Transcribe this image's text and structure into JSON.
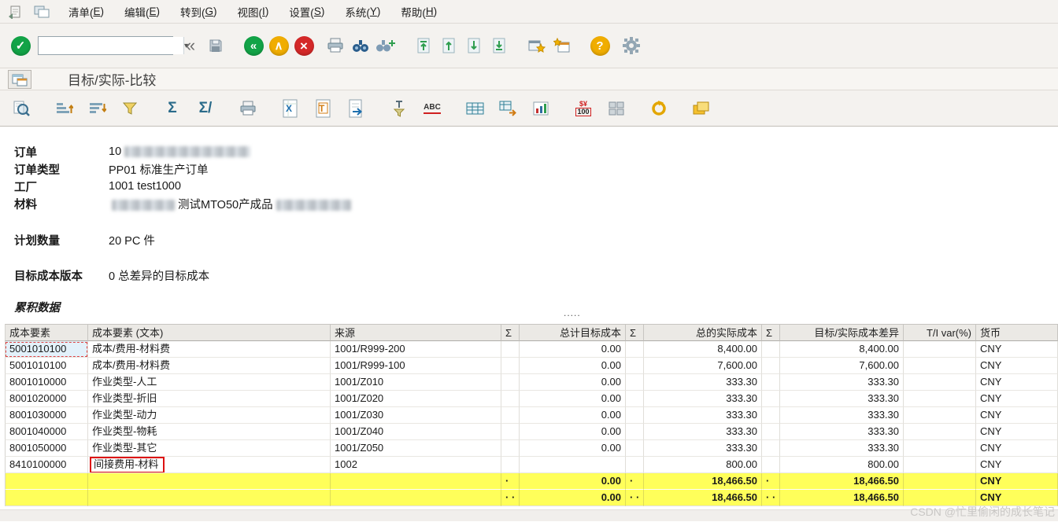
{
  "accent_colors": {
    "enter_green": "#12a347",
    "exit_amber": "#f0ad00",
    "cancel_red": "#d42828",
    "row_highlight_yellow": "#ffff5a",
    "annotation_red": "#dd1111",
    "selection_blue": "#e3f1fa"
  },
  "menubar": {
    "items": [
      {
        "pre": "清单(",
        "key": "E",
        "post": ")"
      },
      {
        "pre": "编辑(",
        "key": "E",
        "post": ")"
      },
      {
        "pre": "转到(",
        "key": "G",
        "post": ")"
      },
      {
        "pre": "视图(",
        "key": "I",
        "post": ")"
      },
      {
        "pre": "设置(",
        "key": "S",
        "post": ")"
      },
      {
        "pre": "系统(",
        "key": "Y",
        "post": ")"
      },
      {
        "pre": "帮助(",
        "key": "H",
        "post": ")"
      }
    ]
  },
  "toolbar": {
    "command_field_value": "",
    "glyphs": {
      "enter": "✓",
      "dropdown": "▾",
      "collapse": "«",
      "back": "«",
      "exit": "∧",
      "cancel": "×",
      "help": "?"
    }
  },
  "titlebar": {
    "title": "目标/实际-比较"
  },
  "app_toolbar": {
    "glyphs": {
      "sum": "Σ",
      "subtotal": "Σ/",
      "spreadsheet": "X",
      "word": "T",
      "abc": "ABC",
      "currency_top": "$¥",
      "currency_bottom": "100"
    }
  },
  "header_info": {
    "order_label": "订单",
    "order_value_visible": "10",
    "order_type_label": "订单类型",
    "order_type_value": "PP01 标准生产订单",
    "plant_label": "工厂",
    "plant_value": "1001 test1000",
    "material_label": "材料",
    "material_value_visible": "测试MTO50产成品",
    "qty_label": "计划数量",
    "qty_value": "20 PC 件",
    "version_label": "目标成本版本",
    "version_value": "0 总差异的目标成本",
    "section_title": "累积数据",
    "separator_dots": "....."
  },
  "table": {
    "headers": {
      "cost_element": "成本要素",
      "cost_element_text": "成本要素 (文本)",
      "origin": "来源",
      "sigma": "Σ",
      "target_cost": "总计目标成本",
      "actual_cost": "总的实际成本",
      "variance": "目标/实际成本差异",
      "ti_var": "T/I var(%)",
      "currency": "货币"
    },
    "rows": [
      {
        "cost_element": "5001010100",
        "text": "成本/费用-材料费",
        "origin": "1001/R999-200",
        "target": "0.00",
        "actual": "8,400.00",
        "variance": "8,400.00",
        "ti_var": "",
        "currency": "CNY"
      },
      {
        "cost_element": "5001010100",
        "text": "成本/费用-材料费",
        "origin": "1001/R999-100",
        "target": "0.00",
        "actual": "7,600.00",
        "variance": "7,600.00",
        "ti_var": "",
        "currency": "CNY"
      },
      {
        "cost_element": "8001010000",
        "text": "作业类型-人工",
        "origin": "1001/Z010",
        "target": "0.00",
        "actual": "333.30",
        "variance": "333.30",
        "ti_var": "",
        "currency": "CNY"
      },
      {
        "cost_element": "8001020000",
        "text": "作业类型-折旧",
        "origin": "1001/Z020",
        "target": "0.00",
        "actual": "333.30",
        "variance": "333.30",
        "ti_var": "",
        "currency": "CNY"
      },
      {
        "cost_element": "8001030000",
        "text": "作业类型-动力",
        "origin": "1001/Z030",
        "target": "0.00",
        "actual": "333.30",
        "variance": "333.30",
        "ti_var": "",
        "currency": "CNY"
      },
      {
        "cost_element": "8001040000",
        "text": "作业类型-物耗",
        "origin": "1001/Z040",
        "target": "0.00",
        "actual": "333.30",
        "variance": "333.30",
        "ti_var": "",
        "currency": "CNY"
      },
      {
        "cost_element": "8001050000",
        "text": "作业类型-其它",
        "origin": "1001/Z050",
        "target": "0.00",
        "actual": "333.30",
        "variance": "333.30",
        "ti_var": "",
        "currency": "CNY"
      },
      {
        "cost_element": "8410100000",
        "text": "间接费用-材料",
        "origin": "1002",
        "target": "",
        "actual": "800.00",
        "variance": "800.00",
        "ti_var": "",
        "currency": "CNY"
      }
    ],
    "subtotal_row": {
      "level_dot": "·",
      "target": "0.00",
      "actual": "18,466.50",
      "variance": "18,466.50",
      "ti_var": "",
      "currency": "CNY"
    },
    "total_row": {
      "level_dot": "· ·",
      "target": "0.00",
      "actual": "18,466.50",
      "variance": "18,466.50",
      "ti_var": "",
      "currency": "CNY"
    }
  },
  "watermark": "CSDN @忙里偷闲的成长笔记"
}
